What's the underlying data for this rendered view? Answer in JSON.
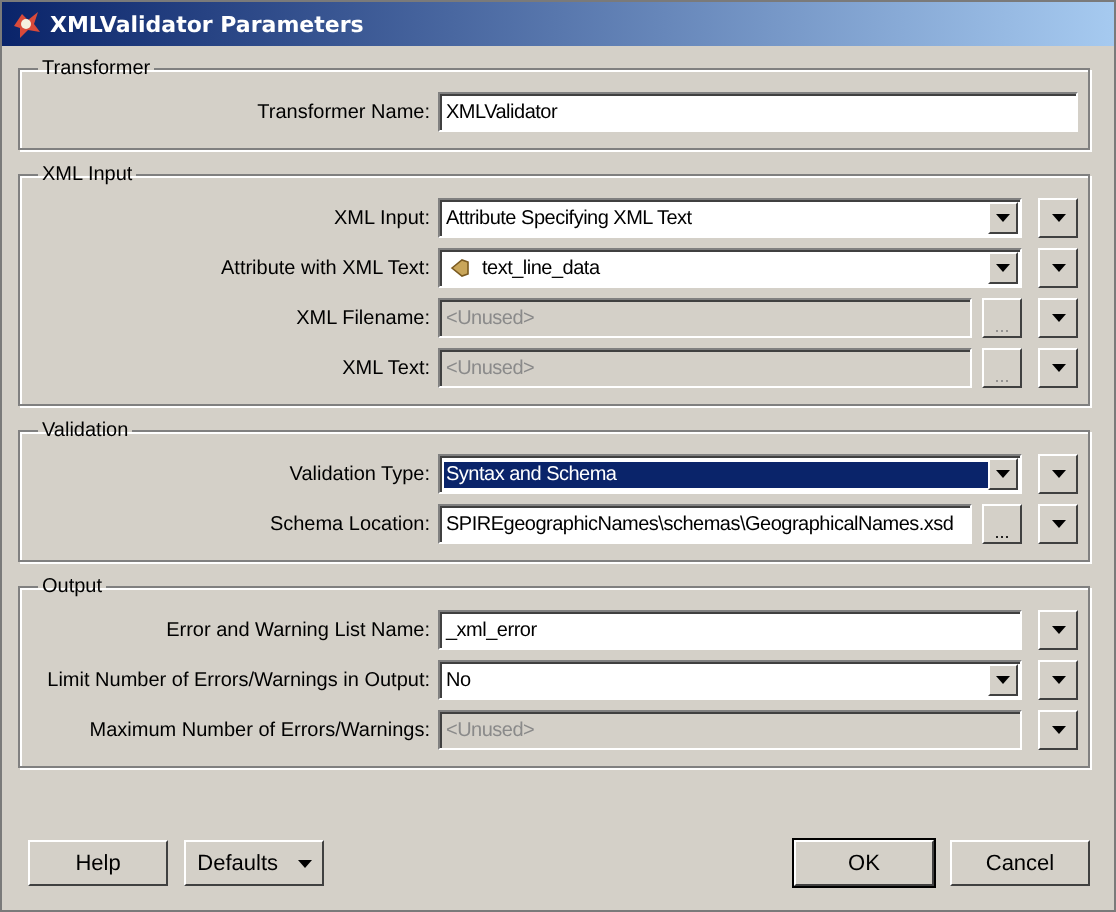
{
  "window": {
    "title": "XMLValidator Parameters"
  },
  "sections": [
    {
      "title": "Transformer",
      "rows": [
        {
          "label": "Transformer Name:",
          "kind": "text",
          "value": "XMLValidator",
          "selected": false,
          "browse": false,
          "menu": false
        }
      ]
    },
    {
      "title": "XML Input",
      "rows": [
        {
          "label": "XML Input:",
          "kind": "combo",
          "value": "Attribute Specifying XML Text",
          "selected": false,
          "browse": false,
          "menu": true
        },
        {
          "label": "Attribute with XML Text:",
          "kind": "attribute",
          "value": "text_line_data",
          "selected": false,
          "browse": false,
          "menu": true
        },
        {
          "label": "XML Filename:",
          "kind": "unused",
          "value": "<Unused>",
          "selected": false,
          "browse": true,
          "menu": true
        },
        {
          "label": "XML Text:",
          "kind": "unused",
          "value": "<Unused>",
          "selected": false,
          "browse": true,
          "menu": true
        }
      ]
    },
    {
      "title": "Validation",
      "rows": [
        {
          "label": "Validation Type:",
          "kind": "combo",
          "value": "Syntax and Schema",
          "selected": true,
          "browse": false,
          "menu": true
        },
        {
          "label": "Schema Location:",
          "kind": "text",
          "value": "SPIREgeographicNames\\schemas\\GeographicalNames.xsd",
          "selected": false,
          "browse": true,
          "menu": true
        }
      ]
    },
    {
      "title": "Output",
      "rows": [
        {
          "label": "Error and Warning List Name:",
          "kind": "text",
          "value": "_xml_error",
          "selected": false,
          "browse": false,
          "menu": true
        },
        {
          "label": "Limit Number of Errors/Warnings in Output:",
          "kind": "combo",
          "value": "No",
          "selected": false,
          "browse": false,
          "menu": true
        },
        {
          "label": "Maximum Number of Errors/Warnings:",
          "kind": "unused",
          "value": "<Unused>",
          "selected": false,
          "browse": false,
          "menu": true
        }
      ]
    }
  ],
  "browse_label": "...",
  "buttons": [
    {
      "label": "Help",
      "kind": "plain"
    },
    {
      "label": "Defaults",
      "kind": "menu"
    },
    {
      "label": "OK",
      "kind": "default"
    },
    {
      "label": "Cancel",
      "kind": "plain"
    }
  ]
}
